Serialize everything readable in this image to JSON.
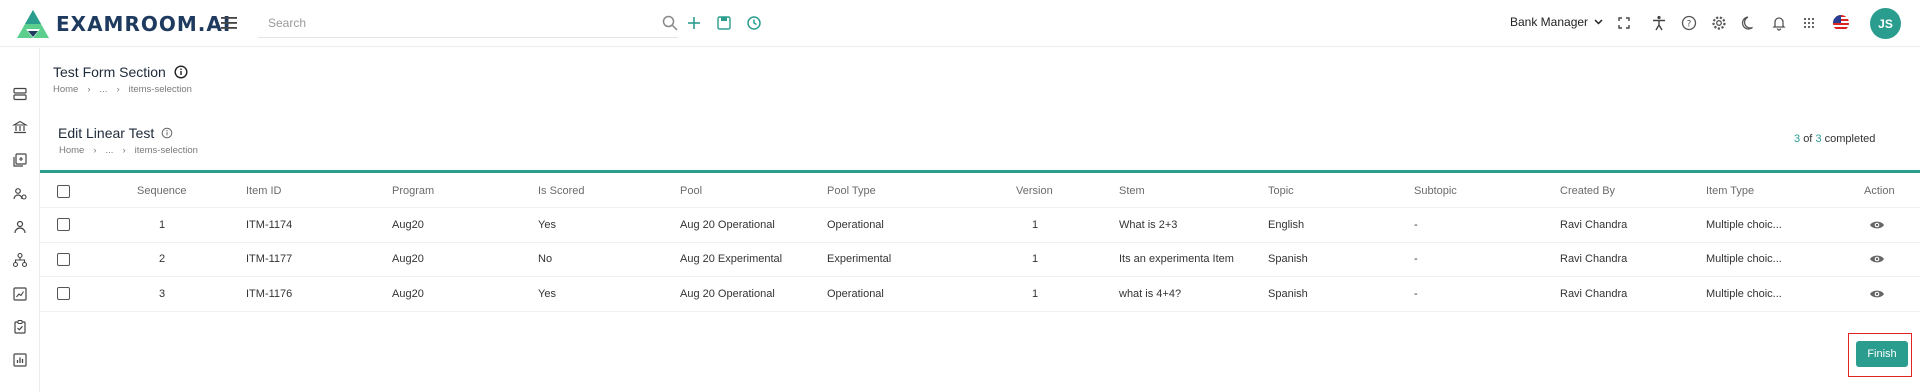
{
  "app": {
    "logo_text": "EXAMROOM.AI",
    "brand_color": "#2a9d8f",
    "highlight_color": "#e02424"
  },
  "topbar": {
    "search_placeholder": "Search",
    "role_label": "Bank Manager",
    "avatar_initials": "JS",
    "icons": [
      "hamburger-icon",
      "search-icon",
      "plus-icon",
      "save-icon",
      "history-icon",
      "chevron-down-icon",
      "fullscreen-icon",
      "accessibility-icon",
      "help-icon",
      "settings-icon",
      "dark-mode-icon",
      "notification-icon",
      "apps-grid-icon",
      "us-flag-icon"
    ]
  },
  "sidebar": {
    "icons": [
      "item-bank-icon",
      "institution-icon",
      "forms-icon",
      "users-icon",
      "user-icon",
      "hierarchy-icon",
      "analytics-icon",
      "checklist-icon",
      "reports-icon"
    ]
  },
  "page": {
    "title": "Test Form Section",
    "breadcrumb": [
      "Home",
      "...",
      "items-selection"
    ]
  },
  "section": {
    "title": "Edit Linear Test",
    "breadcrumb": [
      "Home",
      "...",
      "items-selection"
    ],
    "progress_done": "3",
    "progress_of": "of",
    "progress_total": "3",
    "progress_suffix": "completed"
  },
  "table": {
    "columns": [
      "Sequence",
      "Item ID",
      "Program",
      "Is Scored",
      "Pool",
      "Pool Type",
      "Version",
      "Stem",
      "Topic",
      "Subtopic",
      "Created By",
      "Item Type",
      "Action"
    ],
    "rows": [
      {
        "sequence": "1",
        "item_id": "ITM-1174",
        "program": "Aug20",
        "is_scored": "Yes",
        "pool": "Aug 20 Operational",
        "pool_type": "Operational",
        "version": "1",
        "stem": "What is 2+3",
        "topic": "English",
        "subtopic": "-",
        "created_by": "Ravi Chandra",
        "item_type": "Multiple choic..."
      },
      {
        "sequence": "2",
        "item_id": "ITM-1177",
        "program": "Aug20",
        "is_scored": "No",
        "pool": "Aug 20 Experimental",
        "pool_type": "Experimental",
        "version": "1",
        "stem": "Its an experimenta Item",
        "topic": "Spanish",
        "subtopic": "-",
        "created_by": "Ravi Chandra",
        "item_type": "Multiple choic..."
      },
      {
        "sequence": "3",
        "item_id": "ITM-1176",
        "program": "Aug20",
        "is_scored": "Yes",
        "pool": "Aug 20 Operational",
        "pool_type": "Operational",
        "version": "1",
        "stem": "what is 4+4?",
        "topic": "Spanish",
        "subtopic": "-",
        "created_by": "Ravi Chandra",
        "item_type": "Multiple choic..."
      }
    ]
  },
  "actions": {
    "finish_label": "Finish"
  }
}
